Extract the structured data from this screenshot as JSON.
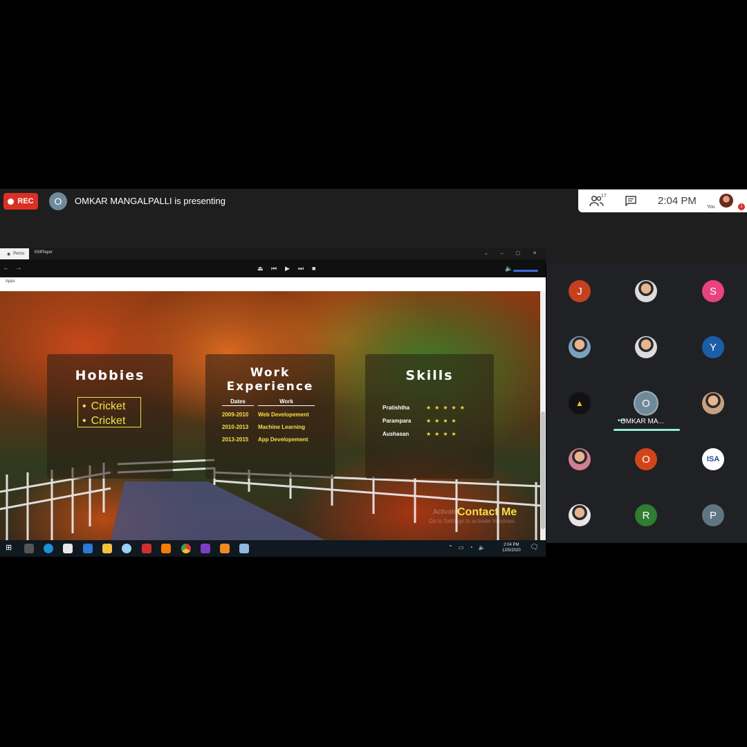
{
  "meet": {
    "rec_label": "REC",
    "presenter_initial": "O",
    "presenting_text": "OMKAR MANGALPALLI is presenting",
    "people_count": "17",
    "time": "2:04 PM",
    "you_label": "You",
    "notification_count": "1"
  },
  "screen": {
    "browser_tab_label": "Perso",
    "player_app": "KMPlayer",
    "apps_label": "Apps",
    "portfolio": {
      "hobbies_title": "Hobbies",
      "hobbies": [
        "Cricket",
        "Cricket"
      ],
      "work_title": "Work Experience",
      "work_headers": [
        "Dates",
        "Work"
      ],
      "work_rows": [
        {
          "dates": "2009-2010",
          "work": "Web Developement"
        },
        {
          "dates": "2010-2013",
          "work": "Machine Learning"
        },
        {
          "dates": "2013-2015",
          "work": "App Developement"
        }
      ],
      "skills_title": "Skills",
      "skills": [
        {
          "name": "Pratishtha",
          "stars": "★★★★★"
        },
        {
          "name": "Parampara",
          "stars": "★★★★"
        },
        {
          "name": "Aushasan",
          "stars": "★★★★"
        }
      ],
      "contact_label": "Contact Me",
      "activate_text": "Activate",
      "activate_sub": "Go to Settings to activate Windows."
    },
    "taskbar_time": "2:04 PM",
    "taskbar_date": "12/5/2020"
  },
  "participants": [
    {
      "initial": "J",
      "color": "#c5401f"
    },
    {
      "initial": "",
      "color": "#dcdcdc",
      "photo": true
    },
    {
      "initial": "S",
      "color": "#e8437f"
    },
    {
      "initial": "",
      "color": "#7aa0c0",
      "photo": true
    },
    {
      "initial": "",
      "color": "#dcdcdc",
      "photo": true
    },
    {
      "initial": "Y",
      "color": "#1b5ea8"
    },
    {
      "initial": "",
      "color": "#111111",
      "logo": true
    },
    {
      "initial": "O",
      "color": "#6f8b9a",
      "speaking_name": "OMKAR MA..."
    },
    {
      "initial": "",
      "color": "#c8a080",
      "photo": true
    },
    {
      "initial": "",
      "color": "#d08090",
      "photo": true
    },
    {
      "initial": "O",
      "color": "#d2451b"
    },
    {
      "initial": "ISA",
      "color": "#ffffff",
      "logo": true
    },
    {
      "initial": "",
      "color": "#e6e6e6",
      "photo": true
    },
    {
      "initial": "R",
      "color": "#2e7d32"
    },
    {
      "initial": "P",
      "color": "#5f7682"
    }
  ]
}
